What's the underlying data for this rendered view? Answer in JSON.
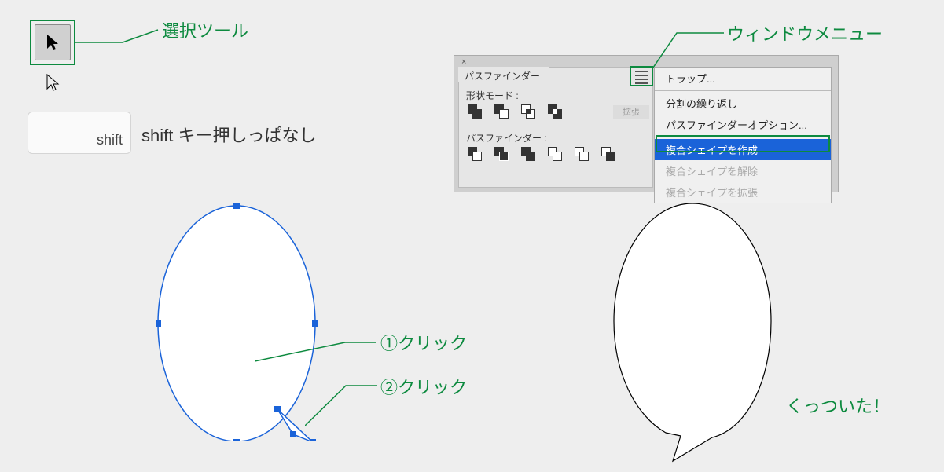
{
  "annotations": {
    "selection_tool": "選択ツール",
    "window_menu": "ウィンドウメニュー",
    "shift_hold": "shift キー押しっぱなし",
    "click1": "①クリック",
    "click2": "②クリック",
    "joined": "くっついた！"
  },
  "keys": {
    "shift": "shift"
  },
  "panel": {
    "tab": "パスファインダー",
    "shape_mode": "形状モード :",
    "pathfinder_label": "パスファインダー :",
    "expand": "拡張",
    "close": "×"
  },
  "flyout": {
    "items": [
      {
        "label": "トラップ...",
        "state": "normal"
      },
      {
        "label": "分割の繰り返し",
        "state": "normal"
      },
      {
        "label": "パスファインダーオプション...",
        "state": "normal"
      },
      {
        "label": "複合シェイプを作成",
        "state": "selected"
      },
      {
        "label": "複合シェイプを解除",
        "state": "disabled"
      },
      {
        "label": "複合シェイプを拡張",
        "state": "disabled"
      }
    ]
  }
}
